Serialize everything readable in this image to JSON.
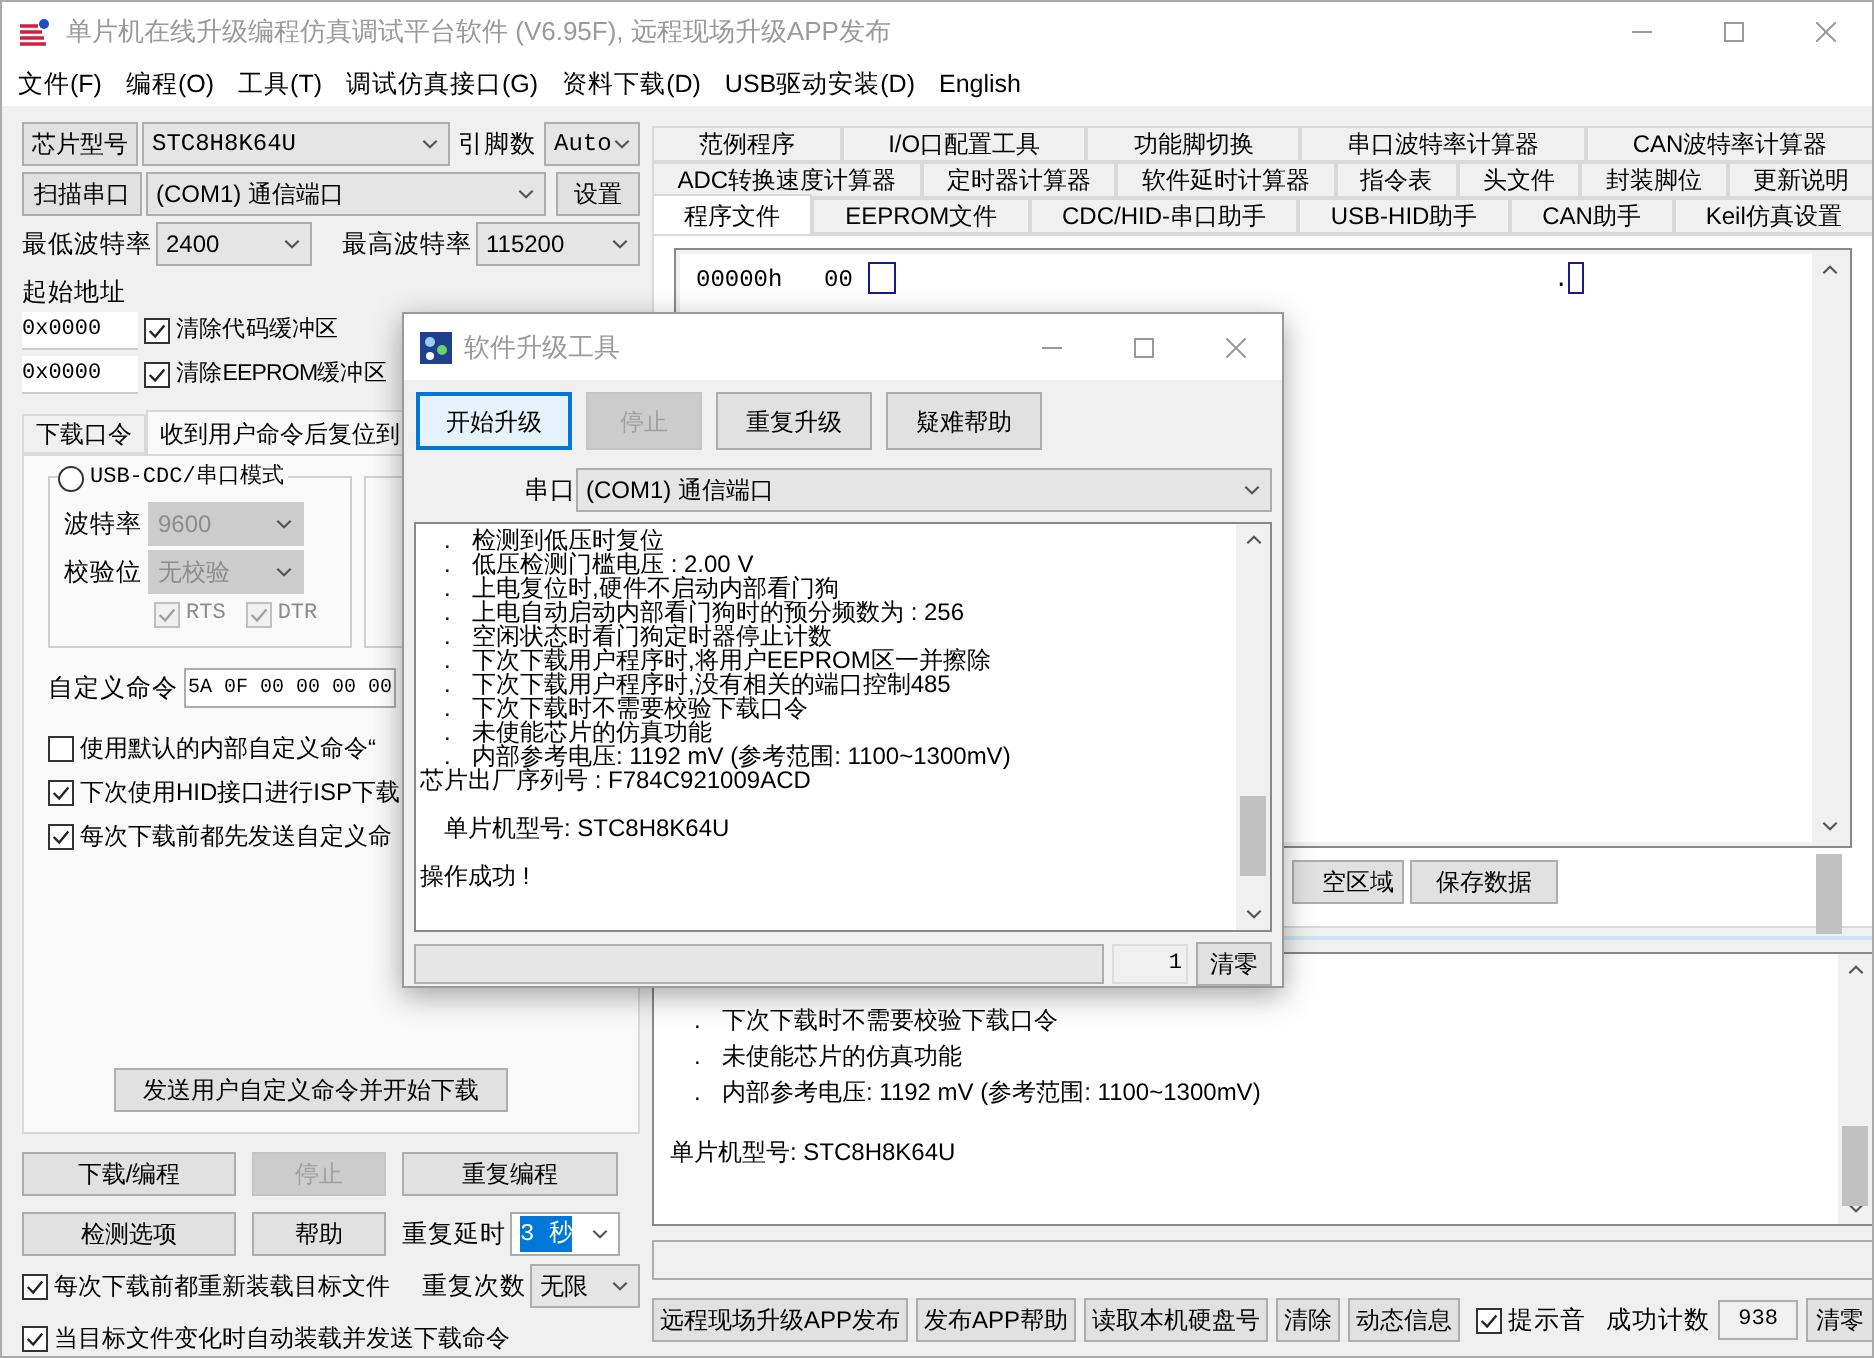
{
  "window": {
    "title": "单片机在线升级编程仿真调试平台软件 (V6.95F), 远程现场升级APP发布"
  },
  "menu": [
    "文件(F)",
    "编程(O)",
    "工具(T)",
    "调试仿真接口(G)",
    "资料下载(D)",
    "USB驱动安装(D)",
    "English"
  ],
  "chip": {
    "button": "芯片型号",
    "value": "STC8H8K64U",
    "pins_label": "引脚数",
    "pins_value": "Auto"
  },
  "port": {
    "button": "扫描串口",
    "value": "(COM1) 通信端口",
    "settings_button": "设置"
  },
  "baud": {
    "min_label": "最低波特率",
    "min_value": "2400",
    "max_label": "最高波特率",
    "max_value": "115200"
  },
  "start_address": {
    "label": "起始地址",
    "rows": [
      {
        "value": "0x0000",
        "checkbox": "清除代码缓冲区",
        "checked": true
      },
      {
        "value": "0x0000",
        "checkbox": "清除EEPROM缓冲区",
        "checked": true
      }
    ]
  },
  "left_tabs": [
    {
      "label": "下载口令",
      "selected": false
    },
    {
      "label": "收到用户命令后复位到",
      "selected": true
    }
  ],
  "reset_panel": {
    "mode_radio": {
      "label": "USB-CDC/串口模式",
      "selected": false
    },
    "baud_label": "波特率",
    "baud_value": "9600",
    "parity_label": "校验位",
    "parity_value": "无校验",
    "fields_disabled": true,
    "line_checks": [
      {
        "label": "RTS",
        "checked": true
      },
      {
        "label": "DTR",
        "checked": true
      }
    ],
    "command_label": "自定义命令",
    "command_value": "5A 0F 00 00 00 00",
    "options": [
      {
        "label": "使用默认的内部自定义命令“",
        "checked": false
      },
      {
        "label": "下次使用HID接口进行ISP下载",
        "checked": true
      },
      {
        "label": "每次下载前都先发送自定义命",
        "checked": true
      }
    ],
    "send_button": "发送用户自定义命令并开始下载"
  },
  "actions": {
    "buttons": [
      {
        "label": "下载/编程",
        "disabled": false
      },
      {
        "label": "停止",
        "disabled": true
      },
      {
        "label": "重复编程",
        "disabled": false
      },
      {
        "label": "检测选项",
        "disabled": false
      },
      {
        "label": "帮助",
        "disabled": false
      }
    ],
    "delay_label": "重复延时",
    "delay_value": "3 秒",
    "delay_highlighted": true,
    "count_label": "重复次数",
    "count_value": "无限",
    "checks": [
      {
        "label": "每次下载前都重新装载目标文件",
        "checked": true
      },
      {
        "label": "当目标文件变化时自动装载并发送下载命令",
        "checked": true
      }
    ]
  },
  "right_tabs": [
    [
      {
        "label": "范例程序",
        "selected": false
      },
      {
        "label": "I/O口配置工具",
        "selected": false
      },
      {
        "label": "功能脚切换",
        "selected": false
      },
      {
        "label": "串口波特率计算器",
        "selected": false
      },
      {
        "label": "CAN波特率计算器",
        "selected": false
      }
    ],
    [
      {
        "label": "ADC转换速度计算器",
        "selected": false
      },
      {
        "label": "定时器计算器",
        "selected": false
      },
      {
        "label": "软件延时计算器",
        "selected": false
      },
      {
        "label": "指令表",
        "selected": false
      },
      {
        "label": "头文件",
        "selected": false
      },
      {
        "label": "封装脚位",
        "selected": false
      },
      {
        "label": "更新说明",
        "selected": false
      }
    ],
    [
      {
        "label": "程序文件",
        "selected": true
      },
      {
        "label": "EEPROM文件",
        "selected": false
      },
      {
        "label": "CDC/HID-串口助手",
        "selected": false
      },
      {
        "label": "USB-HID助手",
        "selected": false
      },
      {
        "label": "CAN助手",
        "selected": false
      },
      {
        "label": "Keil仿真设置",
        "selected": false
      }
    ]
  ],
  "hex": {
    "address": "00000h",
    "byte": "00",
    "ascii": "."
  },
  "hex_buttons": [
    "空区域",
    "保存数据"
  ],
  "log": [
    {
      "kind": "item",
      "bullet": ".",
      "text": "下次下载时不需要校验下载口令"
    },
    {
      "kind": "item",
      "bullet": ".",
      "text": "未使能芯片的仿真功能"
    },
    {
      "kind": "item",
      "bullet": ".",
      "text": "内部参考电压: 1192 mV (参考范围: 1100~1300mV)"
    },
    {
      "kind": "spaced",
      "text": "单片机型号: STC8H8K64U"
    }
  ],
  "bottom_buttons": [
    "远程现场升级APP发布",
    "发布APP帮助",
    "读取本机硬盘号",
    "清除",
    "动态信息"
  ],
  "sound": {
    "label": "提示音",
    "checked": true
  },
  "success": {
    "label": "成功计数",
    "value": "938",
    "reset_button": "清零"
  },
  "dialog": {
    "title": "软件升级工具",
    "buttons": [
      {
        "label": "开始升级",
        "disabled": false,
        "focused": true
      },
      {
        "label": "停止",
        "disabled": true,
        "focused": false
      },
      {
        "label": "重复升级",
        "disabled": false,
        "focused": false
      },
      {
        "label": "疑难帮助",
        "disabled": false,
        "focused": false
      }
    ],
    "port_label": "串口",
    "port_value": "(COM1) 通信端口",
    "log": [
      {
        "kind": "item",
        "bullet": ".",
        "text": "检测到低压时复位"
      },
      {
        "kind": "item",
        "bullet": ".",
        "text": "低压检测门槛电压 : 2.00 V"
      },
      {
        "kind": "item",
        "bullet": ".",
        "text": "上电复位时,硬件不启动内部看门狗"
      },
      {
        "kind": "item",
        "bullet": ".",
        "text": "上电自动启动内部看门狗时的预分频数为 : 256"
      },
      {
        "kind": "item",
        "bullet": ".",
        "text": "空闲状态时看门狗定时器停止计数"
      },
      {
        "kind": "item",
        "bullet": ".",
        "text": "下次下载用户程序时,将用户EEPROM区一并擦除"
      },
      {
        "kind": "item",
        "bullet": ".",
        "text": "下次下载用户程序时,没有相关的端口控制485"
      },
      {
        "kind": "item",
        "bullet": ".",
        "text": "下次下载时不需要校验下载口令"
      },
      {
        "kind": "item",
        "bullet": ".",
        "text": "未使能芯片的仿真功能"
      },
      {
        "kind": "item",
        "bullet": ".",
        "text": "内部参考电压: 1192 mV (参考范围: 1100~1300mV)"
      },
      {
        "kind": "line",
        "text": "芯片出厂序列号 : F784C921009ACD"
      },
      {
        "kind": "spaced_indent",
        "text": "单片机型号: STC8H8K64U"
      },
      {
        "kind": "spaced",
        "text": "操作成功 !"
      }
    ],
    "progress": {
      "level": 0
    },
    "count": "1",
    "reset_button": "清零"
  }
}
